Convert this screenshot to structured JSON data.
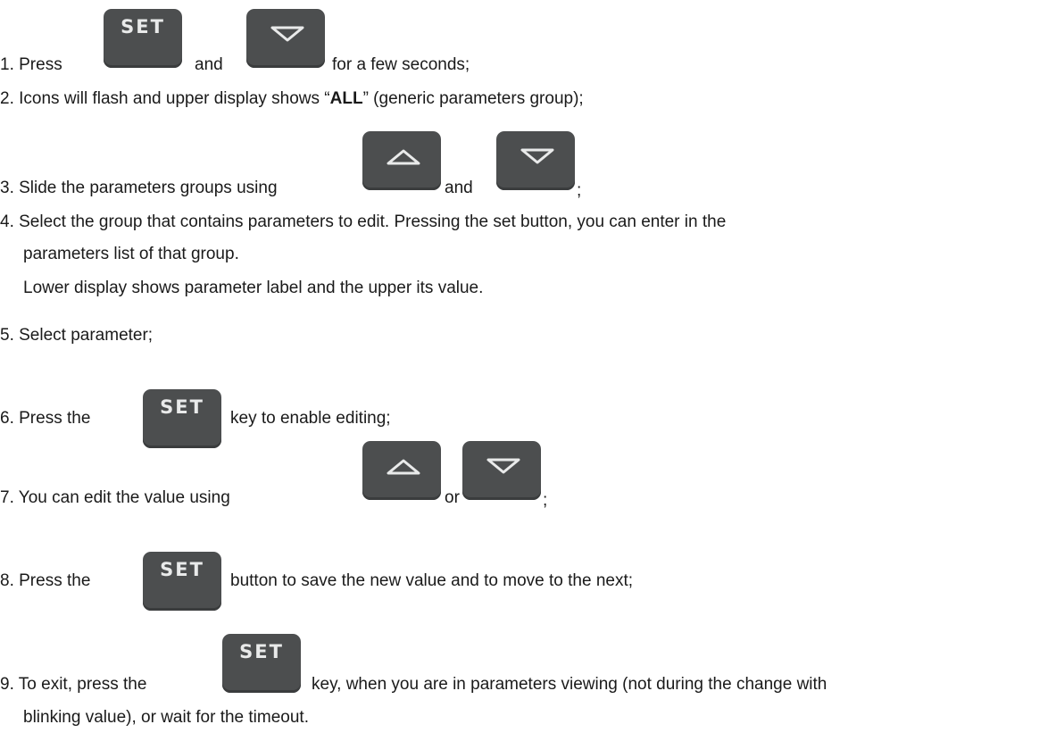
{
  "keys": {
    "set_label": "SET",
    "up_icon": "arrow-up-icon",
    "down_icon": "arrow-down-icon"
  },
  "steps": {
    "s1": {
      "a": "1. Press",
      "b": "and",
      "c": "for a few seconds;"
    },
    "s2": {
      "a": "2. Icons will flash and upper display shows “",
      "bold": "ALL",
      "b": "” (generic parameters group);"
    },
    "s3": {
      "a": "3. Slide the parameters groups using",
      "b": "and",
      "c": ";"
    },
    "s4": {
      "a": "4. Select the group that contains parameters to edit. Pressing the set button, you can enter in the",
      "b": "parameters list of that group.",
      "c": "Lower display shows parameter label and the upper its value."
    },
    "s5": {
      "a": "5. Select parameter;"
    },
    "s6": {
      "a": "6. Press the",
      "b": "key to enable editing;"
    },
    "s7": {
      "a": "7. You can edit the value using",
      "b": "or",
      "c": ";"
    },
    "s8": {
      "a": "8. Press the",
      "b": "button to save the new value and to move to the next;"
    },
    "s9": {
      "a": "9. To exit, press the",
      "b": "key, when you are in parameters viewing (not during the change with",
      "c": "blinking value), or wait for the timeout."
    }
  }
}
